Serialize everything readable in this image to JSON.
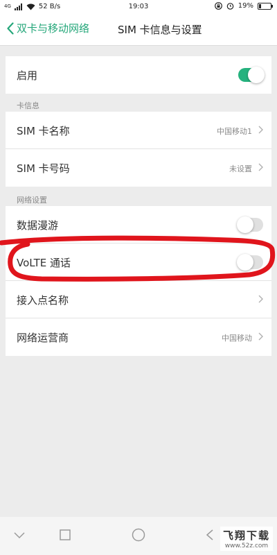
{
  "status_bar": {
    "signal_type": "4G",
    "speed": "52 B/s",
    "time": "19:03",
    "battery_percent": "19%",
    "battery_level": 0.19
  },
  "header": {
    "back_label": "双卡与移动网络",
    "title": "SIM 卡信息与设置"
  },
  "enable": {
    "label": "启用",
    "state": true
  },
  "sections": {
    "card_info": "卡信息",
    "network": "网络设置"
  },
  "card_info": {
    "sim_name_label": "SIM 卡名称",
    "sim_name_value": "中国移动1",
    "sim_number_label": "SIM 卡号码",
    "sim_number_value": "未设置"
  },
  "network": {
    "roaming_label": "数据漫游",
    "roaming_state": false,
    "volte_label": "VoLTE 通话",
    "volte_state": false,
    "apn_label": "接入点名称",
    "carrier_label": "网络运营商",
    "carrier_value": "中国移动"
  },
  "watermark": {
    "title": "飞翔下载",
    "url": "www.52z.com"
  },
  "colors": {
    "accent": "#25b27e",
    "annotation": "#e0151c"
  }
}
